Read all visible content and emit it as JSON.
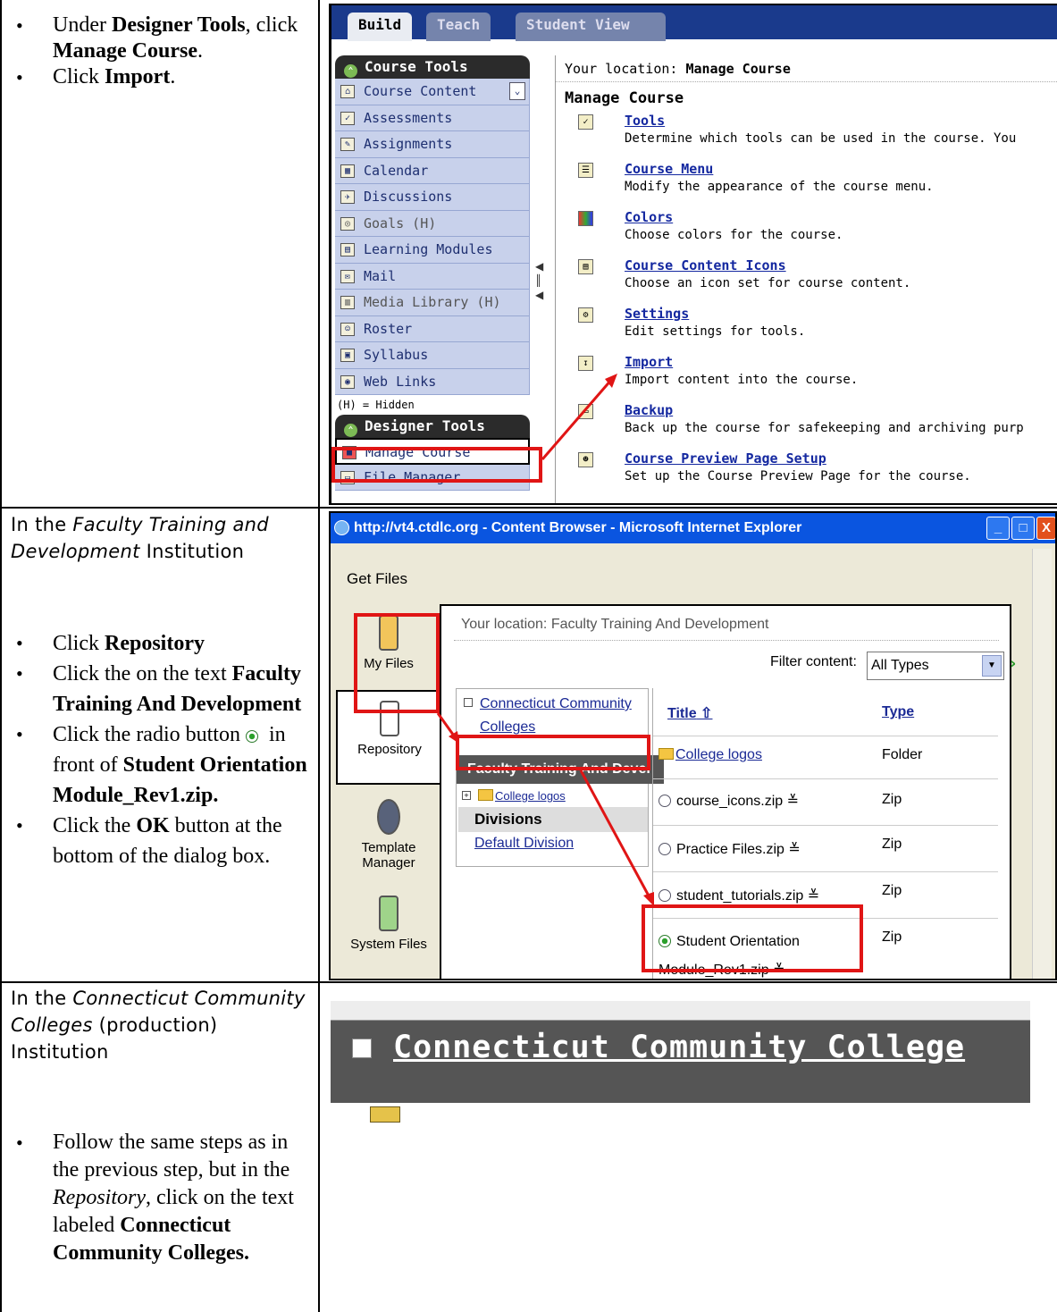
{
  "row1": {
    "steps": [
      {
        "prefix": "Under ",
        "b1": "Designer Tools",
        "mid": ", click ",
        "b2": "Manage Course",
        "suffix": "."
      },
      {
        "prefix": "Click ",
        "b1": "Import",
        "mid": "",
        "b2": "",
        "suffix": "."
      }
    ]
  },
  "row2": {
    "heading_pre": "In the ",
    "heading_em": "Faculty Training and Development",
    "heading_post": " Institution",
    "step1_pre": "Click ",
    "step1_b": "Repository",
    "step2_pre": "Click the on the text ",
    "step2_b": "Faculty Training And Development",
    "step3_pre": "Click the radio button ",
    "step3_mid": " in front of ",
    "step3_b": "Student Orientation Module_Rev1.zip.",
    "step4_pre": "Click the ",
    "step4_b": "OK",
    "step4_post": " button at the bottom of the dialog box."
  },
  "row3": {
    "heading_pre": "In the ",
    "heading_em": "Connecticut Community Colleges",
    "heading_post": " (production) Institution",
    "step_pre": "Follow the same steps as in the previous step, but in the ",
    "step_em": "Repository",
    "step_mid": ", click on the text labeled ",
    "step_b": "Connecticut Community Colleges."
  },
  "panel1": {
    "tabs": [
      "Build",
      "Teach",
      "Student View"
    ],
    "course_tools_header": "Course Tools",
    "course_tools": [
      {
        "label": "Course Content",
        "icon": "home-icon"
      },
      {
        "label": "Assessments",
        "icon": "assessment-icon"
      },
      {
        "label": "Assignments",
        "icon": "assignment-icon"
      },
      {
        "label": "Calendar",
        "icon": "calendar-icon"
      },
      {
        "label": "Discussions",
        "icon": "discussion-icon"
      },
      {
        "label": "Goals (H)",
        "icon": "goals-icon"
      },
      {
        "label": "Learning Modules",
        "icon": "modules-icon"
      },
      {
        "label": "Mail",
        "icon": "mail-icon"
      },
      {
        "label": "Media Library (H)",
        "icon": "media-icon"
      },
      {
        "label": "Roster",
        "icon": "roster-icon"
      },
      {
        "label": "Syllabus",
        "icon": "syllabus-icon"
      },
      {
        "label": "Web Links",
        "icon": "web-icon"
      }
    ],
    "hidden_note": "(H) = Hidden",
    "designer_tools_header": "Designer Tools",
    "designer_tools": [
      {
        "label": "Manage Course",
        "icon": "manage-course-icon"
      },
      {
        "label": "File Manager",
        "icon": "file-manager-icon"
      }
    ],
    "location_label": "Your location: ",
    "location_value": "Manage Course",
    "main_title": "Manage Course",
    "items": [
      {
        "link": "Tools",
        "desc": "Determine which tools can be used in the course. You"
      },
      {
        "link": "Course Menu",
        "desc": "Modify the appearance of the course menu."
      },
      {
        "link": "Colors",
        "desc": "Choose colors for the course."
      },
      {
        "link": "Course Content Icons",
        "desc": "Choose an icon set for course content."
      },
      {
        "link": "Settings",
        "desc": "Edit settings for tools."
      },
      {
        "link": "Import",
        "desc": "Import content into the course."
      },
      {
        "link": "Backup",
        "desc": "Back up the course for safekeeping and archiving purp"
      },
      {
        "link": "Course Preview Page Setup",
        "desc": "Set up the Course Preview Page for the course."
      }
    ]
  },
  "panel2": {
    "window_title": "http://vt4.ctdlc.org - Content Browser - Microsoft Internet Explorer",
    "get_files": "Get Files",
    "nav": [
      "My Files",
      "Repository",
      "Template Manager",
      "System Files"
    ],
    "location": "Your location: Faculty Training And Development",
    "filter_label": "Filter content:",
    "filter_value": "All Types",
    "tree": {
      "root": "Connecticut Community Colleges",
      "selected": "Faculty Training And Devel",
      "child": "College logos",
      "divisions": "Divisions",
      "default_division": "Default Division"
    },
    "columns": {
      "title": "Title",
      "type": "Type"
    },
    "files": [
      {
        "name": "College logos",
        "type": "Folder"
      },
      {
        "name": "course_icons.zip",
        "type": "Zip"
      },
      {
        "name": "Practice Files.zip",
        "type": "Zip"
      },
      {
        "name": "student_tutorials.zip",
        "type": "Zip"
      },
      {
        "name": "Student Orientation Module_Rev1.zip",
        "type": "Zip"
      }
    ]
  },
  "panel3": {
    "text": "Connecticut Community College"
  },
  "colors": {
    "highlight": "#e01515",
    "tab_bar": "#1a3a8c",
    "sidebar": "#c8d1eb",
    "xp_title": "#0a55e0"
  }
}
